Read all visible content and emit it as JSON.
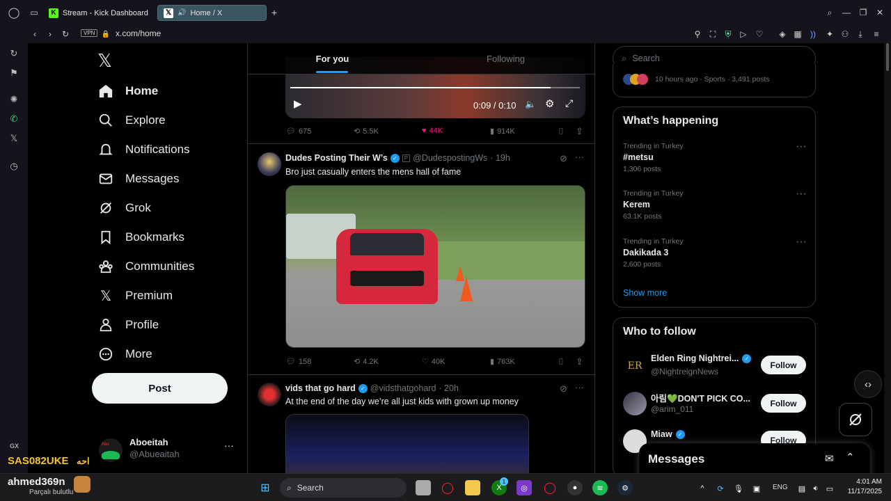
{
  "browser": {
    "tabs": [
      {
        "label": "Stream - Kick Dashboard",
        "active": false
      },
      {
        "label": "Home / X",
        "active": true
      }
    ],
    "vpn_label": "VPN",
    "url": "x.com/home"
  },
  "nav": {
    "items": [
      {
        "label": "Home",
        "icon": "home-icon"
      },
      {
        "label": "Explore",
        "icon": "search-icon"
      },
      {
        "label": "Notifications",
        "icon": "bell-icon"
      },
      {
        "label": "Messages",
        "icon": "envelope-icon"
      },
      {
        "label": "Grok",
        "icon": "grok-icon"
      },
      {
        "label": "Bookmarks",
        "icon": "bookmark-icon"
      },
      {
        "label": "Communities",
        "icon": "people-icon"
      },
      {
        "label": "Premium",
        "icon": "x-logo-icon"
      },
      {
        "label": "Profile",
        "icon": "person-icon"
      },
      {
        "label": "More",
        "icon": "more-circle-icon"
      }
    ],
    "post_label": "Post",
    "account": {
      "name": "Aboeitah",
      "handle": "@Abueaitah",
      "menu": "···"
    }
  },
  "feed": {
    "tabs": [
      {
        "label": "For you",
        "active": true
      },
      {
        "label": "Following",
        "active": false
      }
    ],
    "top_video": {
      "time": "0:09 / 0:10",
      "progress": 0.9
    },
    "top_stats": {
      "replies": "675",
      "reposts": "5.5K",
      "likes": "44K",
      "views": "914K"
    },
    "tweets": [
      {
        "name": "Dudes Posting Their W’s",
        "handle": "@DudespostingWs",
        "time": "· 19h",
        "text": "Bro just casually enters the mens hall of fame",
        "stats": {
          "replies": "158",
          "reposts": "4.2K",
          "likes": "40K",
          "views": "763K"
        }
      },
      {
        "name": "vids that go hard",
        "handle": "@vidsthatgohard",
        "time": "· 20h",
        "text": "At the end of the day we’re all just kids with grown up money"
      }
    ]
  },
  "right": {
    "search_placeholder": "Search",
    "top_trend_meta": "10 hours ago · Sports · 3,491 posts",
    "happening_title": "What’s happening",
    "trends": [
      {
        "context": "Trending in Turkey",
        "name": "#metsu",
        "posts": "1,306 posts"
      },
      {
        "context": "Trending in Turkey",
        "name": "Kerem",
        "posts": "63.1K posts"
      },
      {
        "context": "Trending in Turkey",
        "name": "Dakikada 3",
        "posts": "2,600 posts"
      }
    ],
    "show_more": "Show more",
    "follow_title": "Who to follow",
    "follow_label": "Follow",
    "suggestions": [
      {
        "name": "Elden Ring Nightrei...",
        "handle": "@NightreignNews",
        "avatar_text": "ER"
      },
      {
        "name": "아림💚DON'T PICK CO...",
        "handle": "@arim_011",
        "avatar_text": ""
      },
      {
        "name": "Miaw",
        "handle": "",
        "avatar_text": ""
      }
    ],
    "messages_title": "Messages"
  },
  "overlay": {
    "gx": "GX",
    "stream_name": "SAS082UKE",
    "stream_sub": "احه",
    "viewer_name": "ahmed369n",
    "viewer_sub": "Parçalı bulutlu"
  },
  "taskbar": {
    "search": "Search",
    "lang": "ENG",
    "time": "4:01 AM",
    "date": "11/17/2025",
    "badge": "1"
  }
}
